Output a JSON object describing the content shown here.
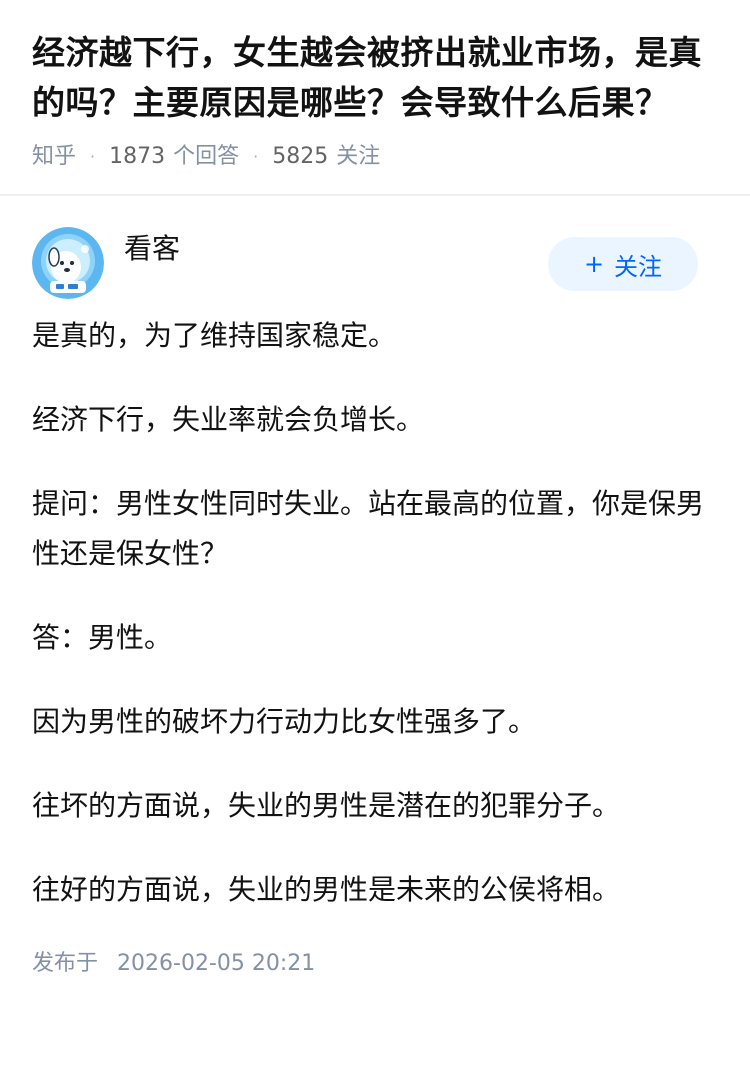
{
  "question": {
    "title": "经济越下行，女生越会被挤出就业市场，是真的吗？主要原因是哪些？会导致什么后果？",
    "source": "知乎",
    "answer_count": "1873",
    "answer_label": "个回答",
    "follow_count": "5825",
    "follow_label": "关注"
  },
  "answer": {
    "author": {
      "name": "看客",
      "avatar_icon": "astronaut-dog-avatar"
    },
    "follow_button": {
      "plus": "+",
      "label": "关注"
    },
    "paragraphs": [
      "是真的，为了维持国家稳定。",
      "经济下行，失业率就会负增长。",
      "提问：男性女性同时失业。站在最高的位置，你是保男性还是保女性？",
      "答：男性。",
      "因为男性的破坏力行动力比女性强多了。",
      "往坏的方面说，失业的男性是潜在的犯罪分子。",
      "往好的方面说，失业的男性是未来的公侯将相。"
    ],
    "publish_label": "发布于",
    "publish_time": "2026-02-05 20:21"
  },
  "colors": {
    "accent": "#0066ff",
    "follow_bg": "#ebf5ff",
    "meta": "#8590a6",
    "text": "#121212",
    "avatar_bg": "#5cb7f0"
  }
}
